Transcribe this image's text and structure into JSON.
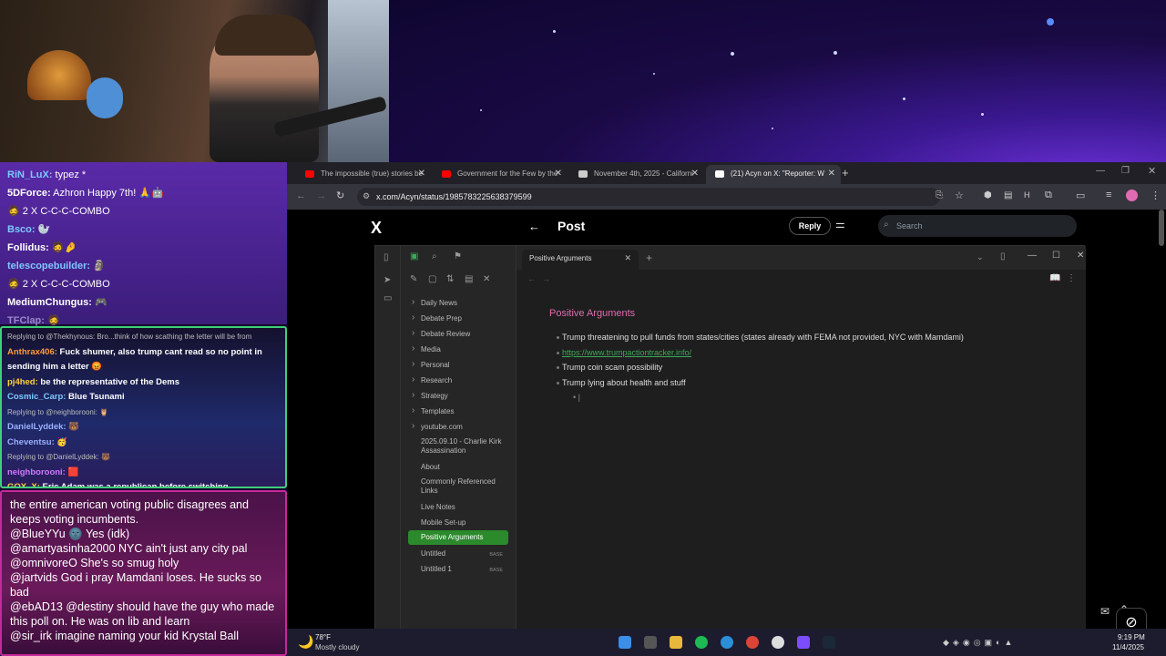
{
  "chat_top": [
    {
      "name": "RiN_LuX:",
      "msg": " typez *",
      "color": "#7ec8ff"
    },
    {
      "name": "5DForce:",
      "msg": " Azhron Happy 7th! 🙏🤖",
      "color": "#ffffff"
    },
    {
      "name": "",
      "msg": "🧔 2 X C-C-C-COMBO",
      "color": "#ffffff"
    },
    {
      "name": "Bsco:",
      "msg": " 🦭",
      "color": "#7ec8ff"
    },
    {
      "name": "Follidus:",
      "msg": " 🧔🤌",
      "color": "#ffffff"
    },
    {
      "name": "telescopebuilder:",
      "msg": "  🗿",
      "color": "#7ec8ff"
    },
    {
      "name": "",
      "msg": "🧔 2 X C-C-C-COMBO",
      "color": "#ffffff"
    },
    {
      "name": "MediumChungus:",
      "msg": " 🎮",
      "color": "#ffffff"
    },
    {
      "name": "TFClap:",
      "msg": " 🧔",
      "color": "#9a88c8"
    }
  ],
  "chat_mid": [
    {
      "type": "reply",
      "text": "Replying to @Thekhynous: Bro...think of how scathing the letter will be from"
    },
    {
      "type": "msg",
      "name": "Anthrax406:",
      "msg": " Fuck shumer, also trump cant read so no point in",
      "color": "#ff9a3a"
    },
    {
      "type": "cont",
      "msg": "sending him a letter 😡"
    },
    {
      "type": "msg",
      "name": "pj4hed:",
      "msg": " be the representative of the Dems",
      "color": "#ffd23a"
    },
    {
      "type": "msg",
      "name": "Cosmic_Carp:",
      "msg": " Blue Tsunami",
      "color": "#7ec8ff"
    },
    {
      "type": "reply",
      "text": "Replying to @neighborooni: 🦉"
    },
    {
      "type": "msg",
      "name": "DanielLyddek:",
      "msg": " 🐻",
      "color": "#9ab0ff"
    },
    {
      "type": "msg",
      "name": "Cheventsu:",
      "msg": " 🥳",
      "color": "#9ab0ff"
    },
    {
      "type": "reply",
      "text": "Replying to @DanielLyddek: 🐻"
    },
    {
      "type": "msg",
      "name": "neighborooni:",
      "msg": " 🟥",
      "color": "#d07aff"
    },
    {
      "type": "msg",
      "name": "GOX_X:",
      "msg": " Eric Adam was a republican before switching",
      "color": "#ffd23a"
    }
  ],
  "chat_bottom": [
    {
      "handle": "",
      "msg": "the entire american voting public disagrees and keeps voting incumbents."
    },
    {
      "handle": "@BlueYYu",
      "msg": " 🌚 Yes (idk)"
    },
    {
      "handle": "@amartyasinha2000",
      "msg": " NYC ain't just any city pal"
    },
    {
      "handle": "@omnivoreO",
      "msg": " She's so smug holy"
    },
    {
      "handle": "@jartvids",
      "msg": " God i pray Mamdani loses. He sucks so bad"
    },
    {
      "handle": "@ebAD13",
      "msg": " @destiny should have the guy who made this poll on. He was on lib and learn"
    },
    {
      "handle": "@sir_irk",
      "msg": " imagine naming your kid Krystal Ball"
    }
  ],
  "browser": {
    "tabs": [
      {
        "title": "The impossible (true) stories be",
        "color": "#ff0000"
      },
      {
        "title": "Government for the Few by the",
        "color": "#ff0000"
      },
      {
        "title": "November 4th, 2025 - Californi",
        "color": "#cccccc"
      },
      {
        "title": "(21) Acyn on X: \"Reporter: W",
        "color": "#ffffff",
        "active": true
      }
    ],
    "url": "x.com/Acyn/status/1985783225638379599"
  },
  "x": {
    "logo": "X",
    "post_title": "Post",
    "reply_label": "Reply",
    "search_placeholder": "Search"
  },
  "obsidian": {
    "active_tab": "Positive Arguments",
    "files": [
      {
        "name": "Daily News",
        "folder": true
      },
      {
        "name": "Debate Prep",
        "folder": true
      },
      {
        "name": "Debate Review",
        "folder": true
      },
      {
        "name": "Media",
        "folder": true
      },
      {
        "name": "Personal",
        "folder": true
      },
      {
        "name": "Research",
        "folder": true
      },
      {
        "name": "Strategy",
        "folder": true
      },
      {
        "name": "Templates",
        "folder": true
      },
      {
        "name": "youtube.com",
        "folder": true
      },
      {
        "name": "2025.09.10 - Charlie Kirk Assassination",
        "folder": false
      },
      {
        "name": "About",
        "folder": false
      },
      {
        "name": "Commonly Referenced Links",
        "folder": false
      },
      {
        "name": "Live Notes",
        "folder": false
      },
      {
        "name": "Mobile Set-up",
        "folder": false
      },
      {
        "name": "Positive Arguments",
        "folder": false,
        "active": true
      },
      {
        "name": "Untitled",
        "folder": false,
        "badge": "BASE"
      },
      {
        "name": "Untitled 1",
        "folder": false,
        "badge": "BASE"
      }
    ],
    "note_heading": "Positive Arguments",
    "bullets": [
      {
        "text": "Trump threatening to pull funds from states/cities (states already with FEMA not provided, NYC with Mamdami)",
        "link": false
      },
      {
        "text": "https://www.trumpactiontracker.info/",
        "link": true
      },
      {
        "text": "Trump coin scam possibility",
        "link": false
      },
      {
        "text": "Trump lying about health and stuff",
        "link": false
      }
    ]
  },
  "taskbar": {
    "weather_temp": "78°F",
    "weather_desc": "Mostly cloudy",
    "time": "9:19 PM",
    "date": "11/4/2025"
  }
}
